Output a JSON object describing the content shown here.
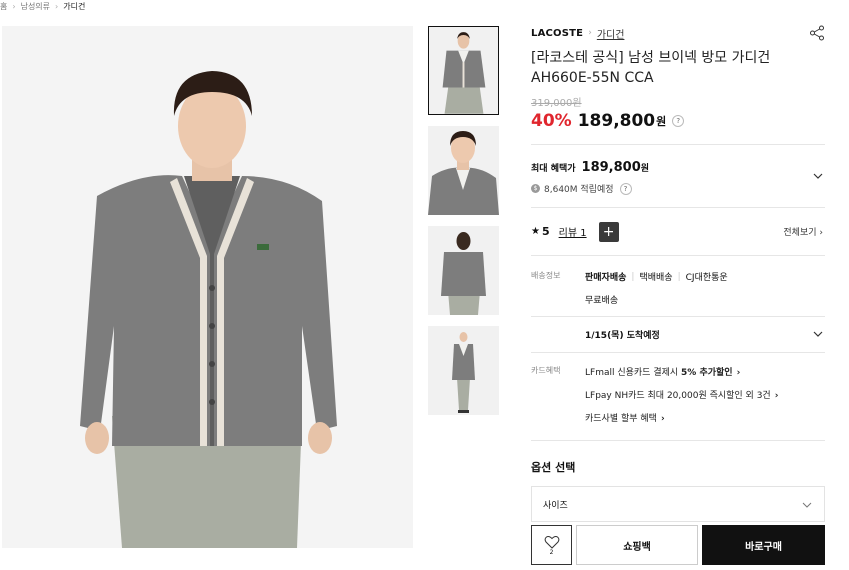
{
  "breadcrumb": {
    "home": "홈",
    "category": "남성의류",
    "current": "가디건"
  },
  "product": {
    "brand": "LACOSTE",
    "category": "가디건",
    "title": "[라코스테 공식] 남성 브이넥 방모 가디건 AH660E-55N CCA",
    "original_price": "319,000원",
    "discount": "40%",
    "price": "189,800",
    "currency": "원"
  },
  "benefit": {
    "label": "최대 혜택가",
    "price": "189,800",
    "currency": "원",
    "points_text": "8,640M 적립예정"
  },
  "review": {
    "score": "5",
    "link": "리뷰 1",
    "view_all": "전체보기"
  },
  "shipping": {
    "label": "배송정보",
    "seller": "판매자배송",
    "type": "택배배송",
    "courier": "CJ대한통운",
    "free": "무료배송",
    "arrival": "1/15(목) 도착예정"
  },
  "card": {
    "label": "카드혜택",
    "line1_pre": "LFmall 신용카드 결제시 ",
    "line1_bold": "5% 추가할인",
    "line2": "LFpay NH카드 최대 20,000원 즉시할인 외 3건",
    "line3": "카드사별 할부 혜택"
  },
  "options": {
    "title": "옵션 선택",
    "size_placeholder": "사이즈"
  },
  "actions": {
    "like_count": "2",
    "bag": "쇼핑백",
    "buy": "바로구매"
  },
  "colors": {
    "discount": "#e0262e",
    "buy_bg": "#111111",
    "sweater": "#7d7d7d"
  }
}
